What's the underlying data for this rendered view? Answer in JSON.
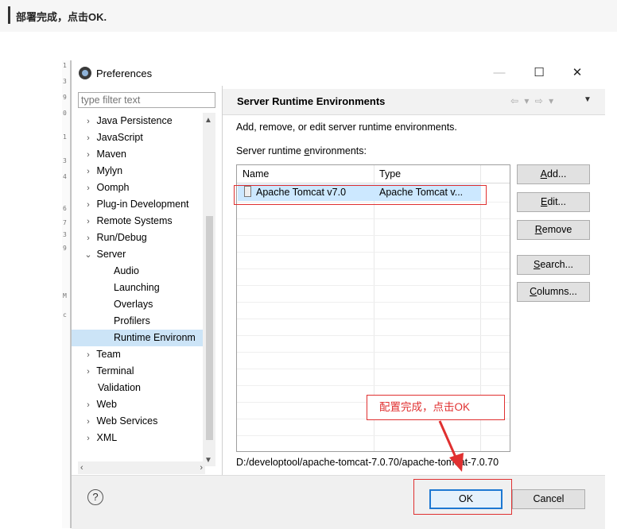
{
  "heading": "部署完成，点击OK.",
  "gutter_chars": [
    "1",
    "3",
    "9",
    "0",
    "1",
    "3",
    "4",
    "6",
    "7",
    "3",
    "9",
    "M",
    "c"
  ],
  "dialog": {
    "title": "Preferences",
    "minimize": "—",
    "maximize": "☐",
    "close": "✕"
  },
  "filter_placeholder": "type filter text",
  "tree": [
    {
      "label": "Java Persistence",
      "arrow": "›",
      "level": 0
    },
    {
      "label": "JavaScript",
      "arrow": "›",
      "level": 0
    },
    {
      "label": "Maven",
      "arrow": "›",
      "level": 0
    },
    {
      "label": "Mylyn",
      "arrow": "›",
      "level": 0
    },
    {
      "label": "Oomph",
      "arrow": "›",
      "level": 0
    },
    {
      "label": "Plug-in Development",
      "arrow": "›",
      "level": 0
    },
    {
      "label": "Remote Systems",
      "arrow": "›",
      "level": 0
    },
    {
      "label": "Run/Debug",
      "arrow": "›",
      "level": 0
    },
    {
      "label": "Server",
      "arrow": "⌄",
      "level": 0
    },
    {
      "label": "Audio",
      "level": 1
    },
    {
      "label": "Launching",
      "level": 1
    },
    {
      "label": "Overlays",
      "level": 1
    },
    {
      "label": "Profilers",
      "level": 1
    },
    {
      "label": "Runtime Environm",
      "level": 1,
      "selected": true
    },
    {
      "label": "Team",
      "arrow": "›",
      "level": 0
    },
    {
      "label": "Terminal",
      "arrow": "›",
      "level": 0
    },
    {
      "label": "Validation",
      "level": 0
    },
    {
      "label": "Web",
      "arrow": "›",
      "level": 0
    },
    {
      "label": "Web Services",
      "arrow": "›",
      "level": 0
    },
    {
      "label": "XML",
      "arrow": "›",
      "level": 0
    }
  ],
  "page": {
    "title": "Server Runtime Environments",
    "nav": "⇦ ▾ ⇨ ▾",
    "menu": "▼",
    "description": "Add, remove, or edit server runtime environments.",
    "list_label_pre": "Server runtime ",
    "list_label_mnemonic": "e",
    "list_label_post": "nvironments:",
    "columns": [
      "Name",
      "Type"
    ],
    "rows": [
      {
        "name": "Apache Tomcat v7.0",
        "type": "Apache Tomcat v..."
      }
    ],
    "path": "D:/developtool/apache-tomcat-7.0.70/apache-tomcat-7.0.70"
  },
  "buttons": {
    "add": {
      "m": "A",
      "rest": "dd..."
    },
    "edit": {
      "m": "E",
      "rest": "dit..."
    },
    "remove": {
      "m": "R",
      "rest": "emove"
    },
    "search": {
      "m": "S",
      "rest": "earch..."
    },
    "columns": {
      "m": "C",
      "rest": "olumns..."
    },
    "ok": "OK",
    "cancel": "Cancel"
  },
  "annotation": "配置完成，点击OK",
  "colors": {
    "annotation_red": "#e03030",
    "selection": "#cce8ff",
    "ok_border": "#1e78d2"
  }
}
